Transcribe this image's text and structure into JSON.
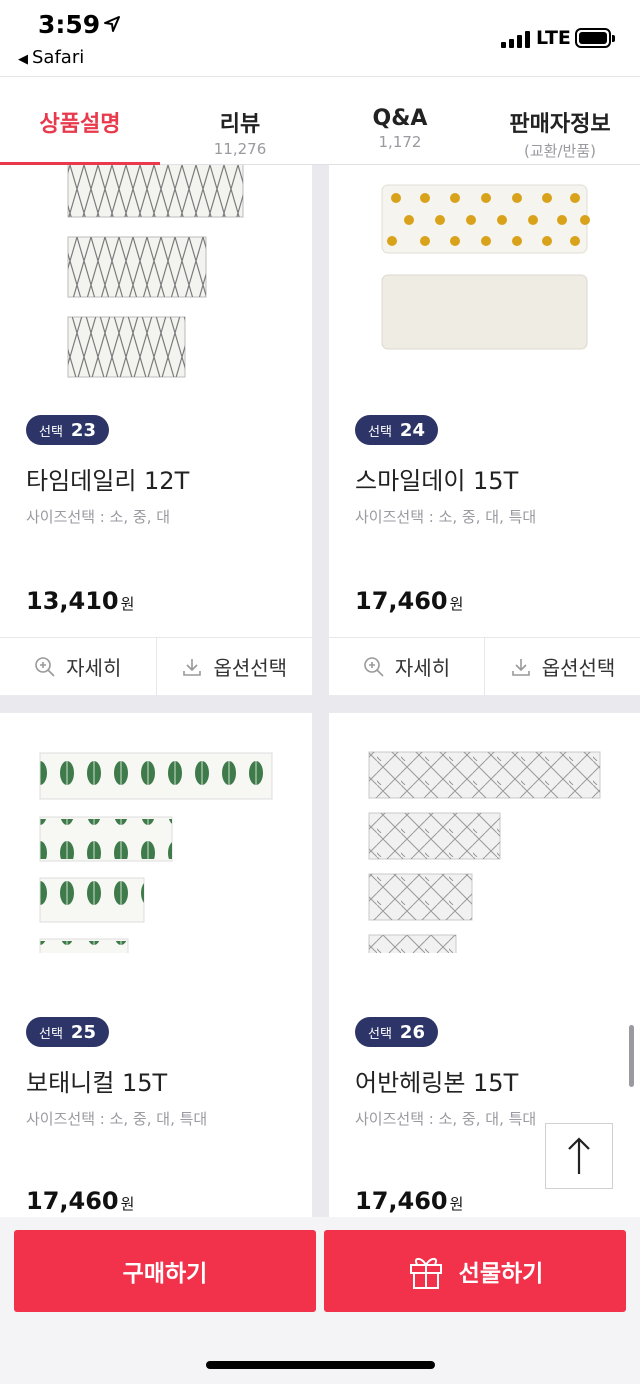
{
  "status": {
    "time": "3:59",
    "back_app": "Safari",
    "network": "LTE"
  },
  "tabs": [
    {
      "label": "상품설명",
      "sub": ""
    },
    {
      "label": "리뷰",
      "sub": "11,276"
    },
    {
      "label": "Q&A",
      "sub": "1,172"
    },
    {
      "label": "판매자정보",
      "sub": "(교환/반품)"
    }
  ],
  "products": [
    {
      "badge_label": "선택",
      "badge_num": "23",
      "name": "타임데일리 12T",
      "sizes": "사이즈선택 : 소, 중, 대",
      "price": "13,410",
      "currency": "원"
    },
    {
      "badge_label": "선택",
      "badge_num": "24",
      "name": "스마일데이 15T",
      "sizes": "사이즈선택 : 소, 중, 대, 특대",
      "price": "17,460",
      "currency": "원"
    },
    {
      "badge_label": "선택",
      "badge_num": "25",
      "name": "보태니컬 15T",
      "sizes": "사이즈선택 : 소, 중, 대, 특대",
      "price": "17,460",
      "currency": "원"
    },
    {
      "badge_label": "선택",
      "badge_num": "26",
      "name": "어반헤링본 15T",
      "sizes": "사이즈선택 : 소, 중, 대, 특대",
      "price": "17,460",
      "currency": "원"
    }
  ],
  "actions": {
    "detail": "자세히",
    "option": "옵션선택"
  },
  "bottom": {
    "buy": "구매하기",
    "gift": "선물하기"
  },
  "colors": {
    "accent": "#f2314a",
    "tab_active": "#e83a4c",
    "badge": "#2d3467"
  }
}
